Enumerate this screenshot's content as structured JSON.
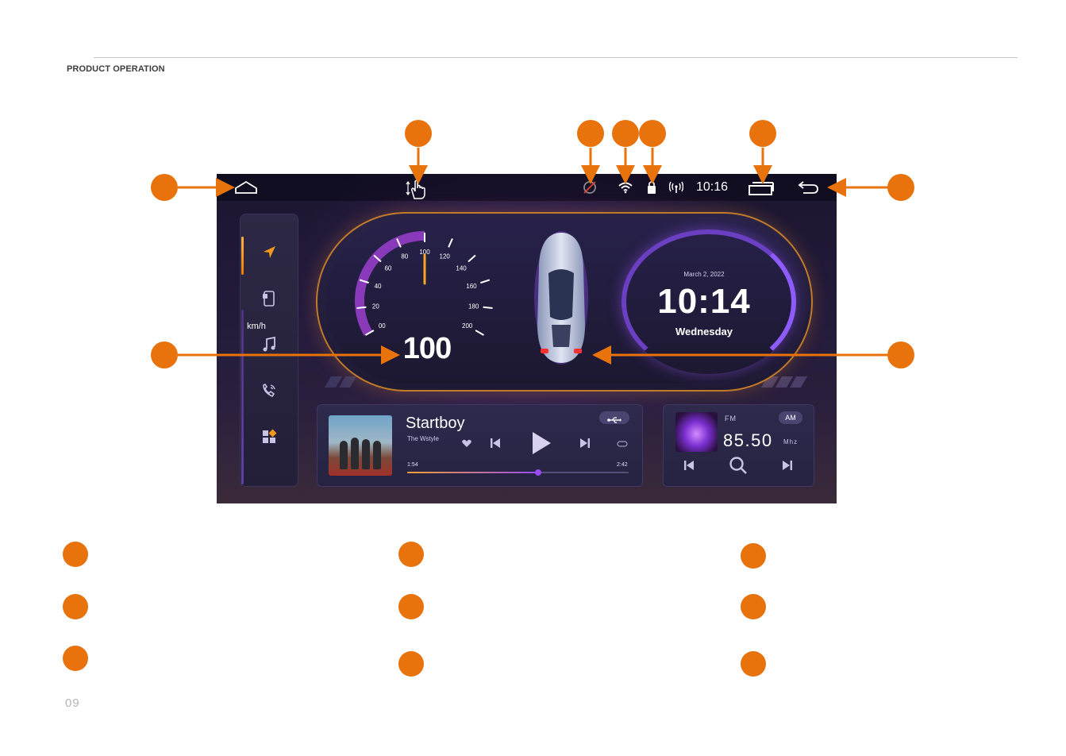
{
  "page": {
    "section_title": "PRODUCT OPERATION",
    "page_number": "09"
  },
  "statusbar": {
    "time": "10:16"
  },
  "dashboard": {
    "speed_value": "100",
    "speed_unit": "km/h",
    "gauge_ticks": [
      "00",
      "20",
      "40",
      "60",
      "80",
      "100",
      "120",
      "140",
      "160",
      "180",
      "200"
    ],
    "clock_date": "March 2, 2022",
    "clock_time": "10:14",
    "clock_day": "Wednesday"
  },
  "media": {
    "title": "Startboy",
    "artist": "The Wstyle",
    "elapsed": "1:54",
    "total": "2:42",
    "progress": 0.59
  },
  "radio": {
    "band": "FM",
    "alt_band": "AM",
    "frequency": "85.50",
    "unit": "Mhz"
  },
  "colors": {
    "callout": "#e8720c",
    "accent_purple": "#8e5bff",
    "accent_orange": "#f0a030"
  },
  "icons": [
    "home-icon",
    "gesture-icon",
    "gps-off-icon",
    "wifi-icon",
    "usb-lock-icon",
    "signal-icon",
    "recent-apps-icon",
    "back-icon",
    "navigation-icon",
    "phone-link-icon",
    "music-icon",
    "call-icon",
    "apps-icon",
    "heart-icon",
    "prev-icon",
    "play-icon",
    "next-icon",
    "repeat-icon",
    "usb-icon",
    "search-icon"
  ]
}
